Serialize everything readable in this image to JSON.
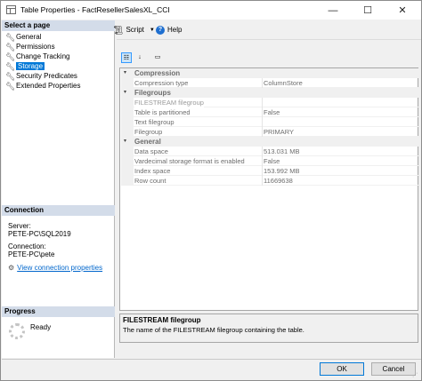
{
  "window": {
    "title": "Table Properties - FactResellerSalesXL_CCI",
    "minimize_glyph": "—",
    "maximize_glyph": "☐",
    "close_glyph": "✕"
  },
  "left_pane": {
    "select_page_header": "Select a page",
    "pages": [
      {
        "label": "General",
        "icon": "wrench-icon"
      },
      {
        "label": "Permissions",
        "icon": "wrench-icon"
      },
      {
        "label": "Change Tracking",
        "icon": "wrench-icon"
      },
      {
        "label": "Storage",
        "icon": "wrench-icon",
        "selected": true
      },
      {
        "label": "Security Predicates",
        "icon": "wrench-icon"
      },
      {
        "label": "Extended Properties",
        "icon": "wrench-icon"
      }
    ],
    "connection_header": "Connection",
    "server_label": "Server:",
    "server_value": "PETE-PC\\SQL2019",
    "connection_label": "Connection:",
    "connection_value": "PETE-PC\\pete",
    "view_connection_link": "View connection properties",
    "progress_header": "Progress",
    "progress_status": "Ready"
  },
  "toolbar": {
    "script_label": "Script",
    "help_label": "Help"
  },
  "grid": {
    "categories": [
      {
        "name": "Compression",
        "rows": [
          {
            "name": "Compression type",
            "value": "ColumnStore"
          }
        ]
      },
      {
        "name": "Filegroups",
        "rows": [
          {
            "name": "FILESTREAM filegroup",
            "value": ""
          },
          {
            "name": "Table is partitioned",
            "value": "False"
          },
          {
            "name": "Text filegroup",
            "value": ""
          },
          {
            "name": "Filegroup",
            "value": "PRIMARY"
          }
        ]
      },
      {
        "name": "General",
        "rows": [
          {
            "name": "Data space",
            "value": "513.031 MB"
          },
          {
            "name": "Vardecimal storage format is enabled",
            "value": "False"
          },
          {
            "name": "Index space",
            "value": "153.992 MB"
          },
          {
            "name": "Row count",
            "value": "11669638"
          }
        ]
      }
    ]
  },
  "description": {
    "title": "FILESTREAM filegroup",
    "text": "The name of the FILESTREAM filegroup containing the table."
  },
  "buttons": {
    "ok": "OK",
    "cancel": "Cancel"
  },
  "colors": {
    "selection": "#0078d7",
    "section_header": "#d3dce9",
    "link": "#0066cc"
  }
}
